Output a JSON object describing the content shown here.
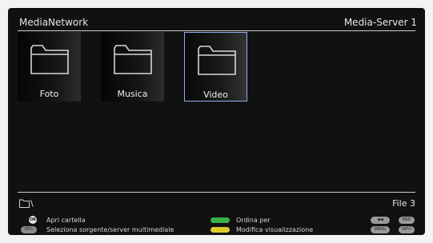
{
  "header": {
    "title": "MediaNetwork",
    "server": "Media-Server 1"
  },
  "folders": [
    {
      "label": "Foto",
      "selected": false,
      "icon": "folder-icon"
    },
    {
      "label": "Musica",
      "selected": false,
      "icon": "folder-icon"
    },
    {
      "label": "Video",
      "selected": true,
      "icon": "folder-icon"
    }
  ],
  "status": {
    "path": "\\",
    "path_icon": "folder-icon",
    "file_count": "File 3"
  },
  "footer": {
    "ok_key": "OK",
    "ok_label": "Apri cartella",
    "epg_key": "EPG",
    "epg_label": "Seleziona sorgente/server multimediale",
    "green_label": "Ordina per",
    "yellow_label": "Modifica visualizzazione",
    "rewind_key": "◀◀",
    "end_key": "END",
    "menu_key": "MENU",
    "info_key": "INFO"
  },
  "colors": {
    "selection_border": "#8fb0e6",
    "green_key": "#36b14a",
    "yellow_key": "#d9cc2a"
  }
}
